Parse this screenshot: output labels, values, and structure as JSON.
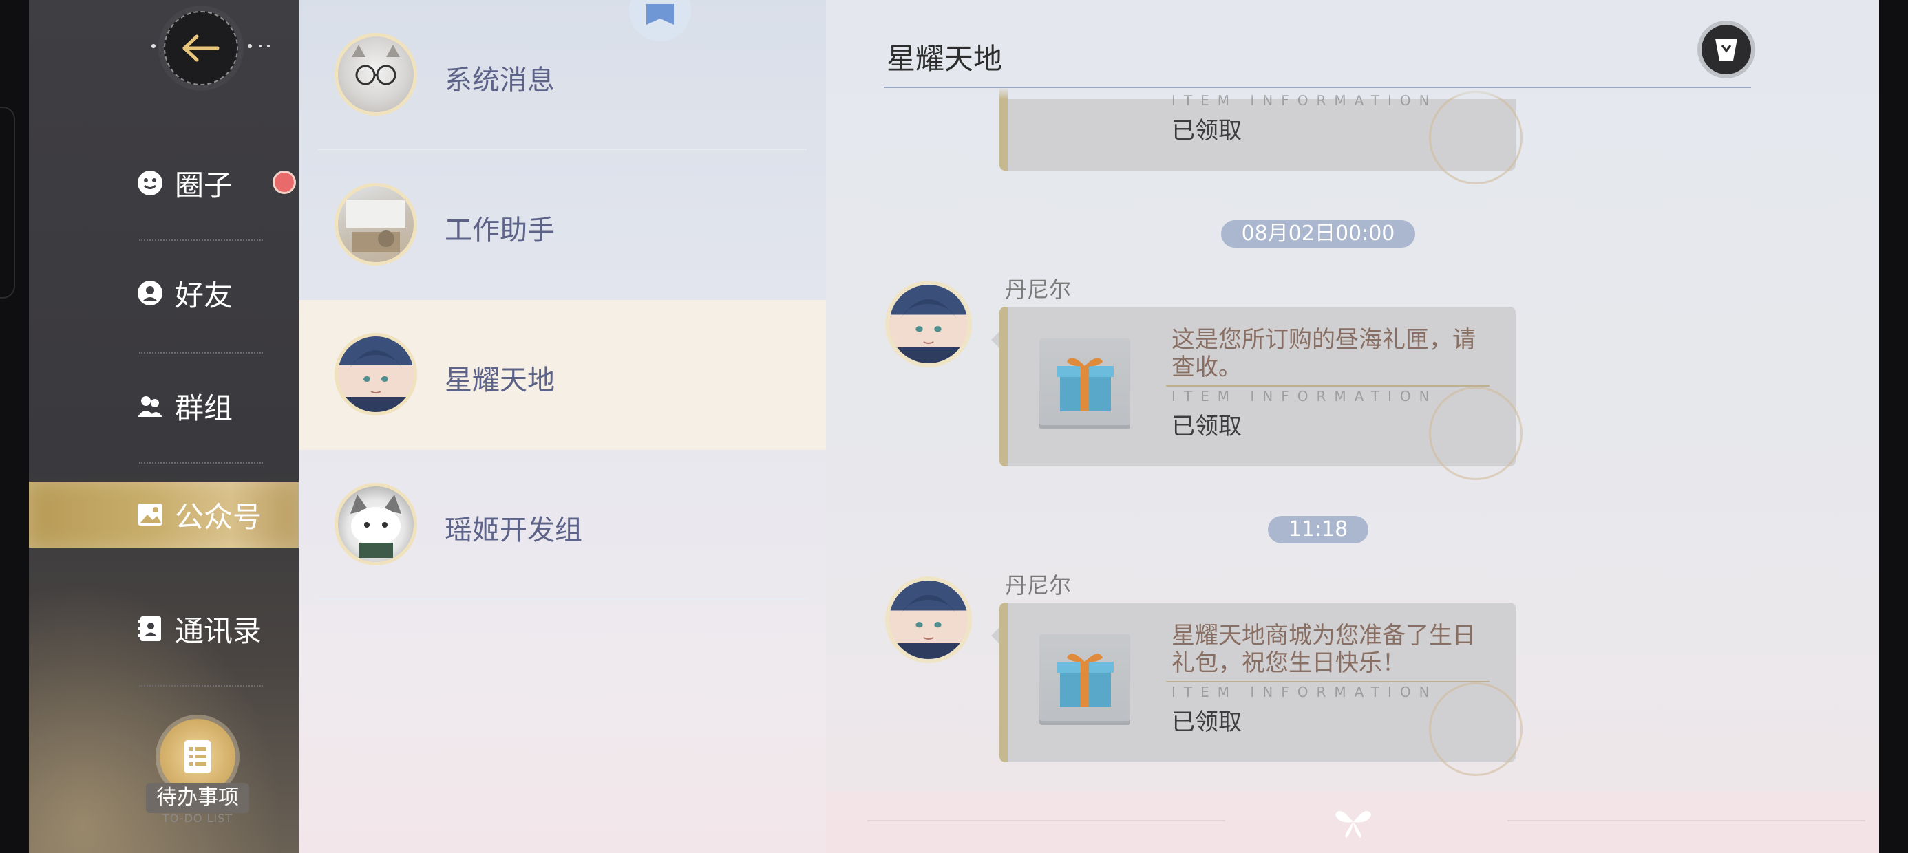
{
  "nav": {
    "items": [
      {
        "label": "圈子",
        "icon": "smile-icon",
        "has_badge": true
      },
      {
        "label": "好友",
        "icon": "friend-icon",
        "has_badge": false
      },
      {
        "label": "群组",
        "icon": "group-icon",
        "has_badge": false
      },
      {
        "label": "公众号",
        "icon": "image-icon",
        "active": true
      },
      {
        "label": "通讯录",
        "icon": "contacts-icon",
        "has_badge": false
      }
    ],
    "todo": {
      "label": "待办事项",
      "sublabel": "TO-DO LIST"
    }
  },
  "contacts": [
    {
      "name": "系统消息",
      "avatar": "cat-glasses"
    },
    {
      "name": "工作助手",
      "avatar": "workspace"
    },
    {
      "name": "星耀天地",
      "avatar": "blue-hair-boy",
      "selected": true
    },
    {
      "name": "瑶姬开发组",
      "avatar": "cat-mascot"
    }
  ],
  "chat": {
    "title": "星耀天地",
    "messages": [
      {
        "type": "partial-card",
        "item_info": "ITEM INFORMATION",
        "status": "已领取"
      },
      {
        "time": "08月02日00:00",
        "sender": "丹尼尔",
        "text": "这是您所订购的昼海礼匣，请查收。",
        "item_info": "ITEM INFORMATION",
        "status": "已领取"
      },
      {
        "time": "11:18",
        "sender": "丹尼尔",
        "text": "星耀天地商城为您准备了生日礼包，祝您生日快乐！",
        "item_info": "ITEM INFORMATION",
        "status": "已领取"
      }
    ]
  },
  "colors": {
    "nav_bg": "#3f3e43",
    "nav_active": "#c8ad6b",
    "badge": "#e86a6a",
    "time_pill": "#aab7cf",
    "card_bg": "#d0d0d2",
    "contact_name": "#5d6388"
  }
}
